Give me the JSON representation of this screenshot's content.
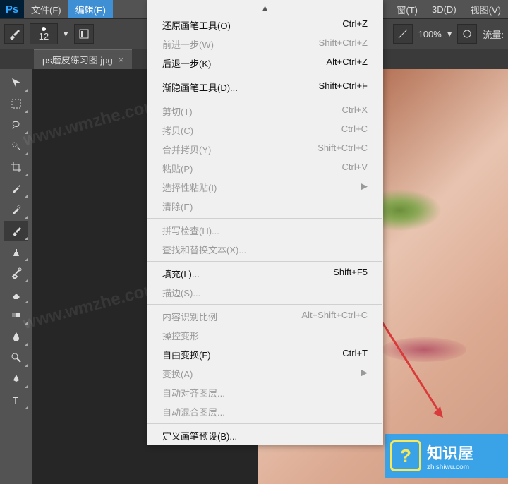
{
  "menubar": {
    "logo": "Ps",
    "file": "文件(F)",
    "edit": "编辑(E)",
    "window_char": "窗(T)",
    "threeD": "3D(D)",
    "view": "视图(V)"
  },
  "optbar": {
    "brush_size": "12",
    "zoom": "100%",
    "flow_label": "流量:"
  },
  "tab": {
    "name": "ps磨皮练习图.jpg",
    "close": "×"
  },
  "dropdown": {
    "scroll_up": "▲",
    "items": [
      {
        "label": "还原画笔工具(O)",
        "shortcut": "Ctrl+Z",
        "enabled": true
      },
      {
        "label": "前进一步(W)",
        "shortcut": "Shift+Ctrl+Z",
        "enabled": false
      },
      {
        "label": "后退一步(K)",
        "shortcut": "Alt+Ctrl+Z",
        "enabled": true
      },
      {
        "sep": true
      },
      {
        "label": "渐隐画笔工具(D)...",
        "shortcut": "Shift+Ctrl+F",
        "enabled": true
      },
      {
        "sep": true
      },
      {
        "label": "剪切(T)",
        "shortcut": "Ctrl+X",
        "enabled": false
      },
      {
        "label": "拷贝(C)",
        "shortcut": "Ctrl+C",
        "enabled": false
      },
      {
        "label": "合并拷贝(Y)",
        "shortcut": "Shift+Ctrl+C",
        "enabled": false
      },
      {
        "label": "粘贴(P)",
        "shortcut": "Ctrl+V",
        "enabled": false
      },
      {
        "label": "选择性粘贴(I)",
        "shortcut": "",
        "enabled": false,
        "submenu": true
      },
      {
        "label": "清除(E)",
        "shortcut": "",
        "enabled": false
      },
      {
        "sep": true
      },
      {
        "label": "拼写检查(H)...",
        "shortcut": "",
        "enabled": false
      },
      {
        "label": "查找和替换文本(X)...",
        "shortcut": "",
        "enabled": false
      },
      {
        "sep": true
      },
      {
        "label": "填充(L)...",
        "shortcut": "Shift+F5",
        "enabled": true
      },
      {
        "label": "描边(S)...",
        "shortcut": "",
        "enabled": false
      },
      {
        "sep": true
      },
      {
        "label": "内容识别比例",
        "shortcut": "Alt+Shift+Ctrl+C",
        "enabled": false
      },
      {
        "label": "操控变形",
        "shortcut": "",
        "enabled": false
      },
      {
        "label": "自由变换(F)",
        "shortcut": "Ctrl+T",
        "enabled": true
      },
      {
        "label": "变换(A)",
        "shortcut": "",
        "enabled": false,
        "submenu": true
      },
      {
        "label": "自动对齐图层...",
        "shortcut": "",
        "enabled": false
      },
      {
        "label": "自动混合图层...",
        "shortcut": "",
        "enabled": false
      },
      {
        "sep": true
      },
      {
        "label": "定义画笔预设(B)...",
        "shortcut": "",
        "enabled": true
      }
    ]
  },
  "watermark": "www.wmzhe.com",
  "badge": {
    "title": "知识屋",
    "sub": "zhishiwu.com",
    "q": "?"
  }
}
